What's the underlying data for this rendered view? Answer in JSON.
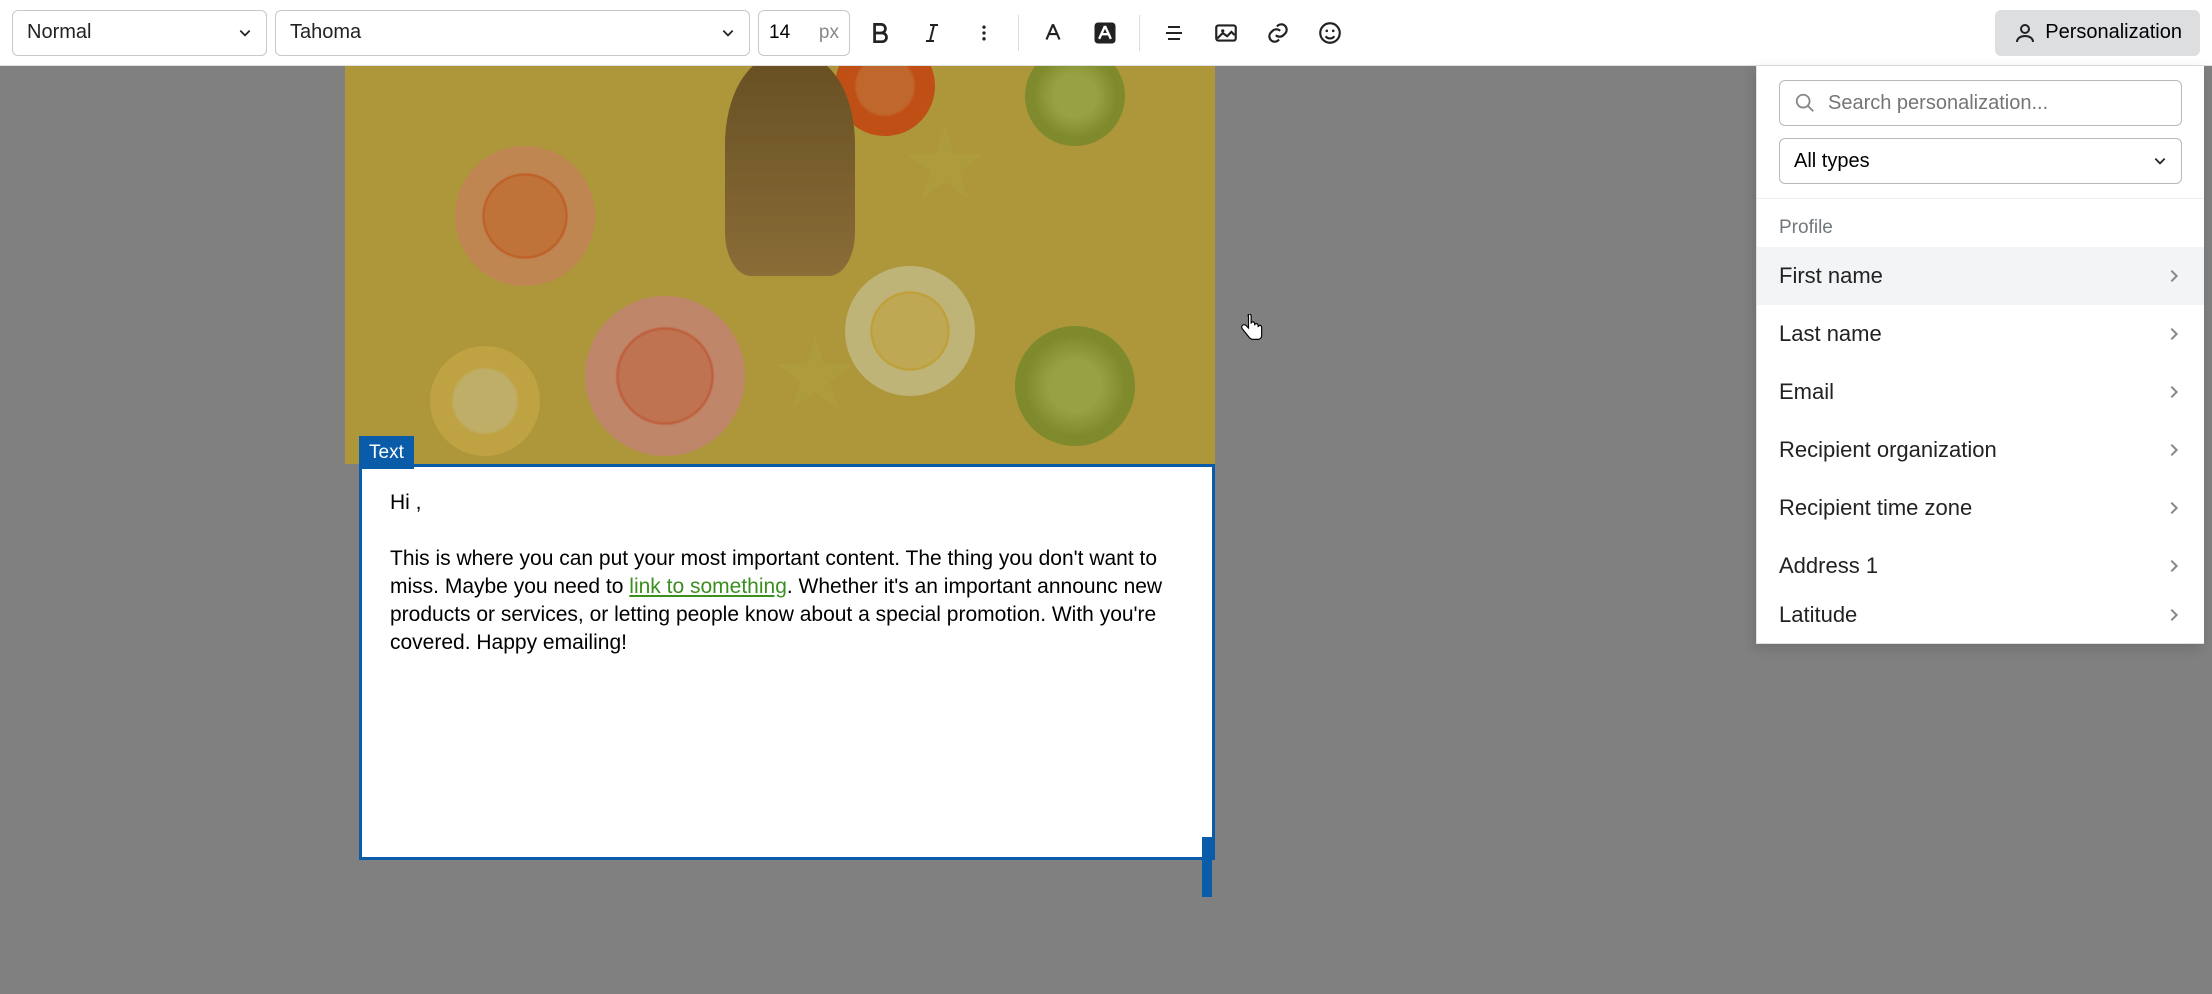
{
  "toolbar": {
    "style": "Normal",
    "font": "Tahoma",
    "size_value": "14",
    "size_unit": "px",
    "bold_label": "Bold",
    "italic_label": "Italic",
    "personalization_label": "Personalization"
  },
  "text_block": {
    "tag_label": "Text",
    "greeting": "Hi ,",
    "body_pre": "This is where you can put your most important content. The thing you don't want to miss. Maybe you need to ",
    "link_text": "link to something",
    "body_post": ". Whether it's an important announc new products or services, or letting people know about a special promotion. With you're covered. Happy emailing!"
  },
  "panel": {
    "search_placeholder": "Search personalization...",
    "type_filter": "All types",
    "section_label": "Profile",
    "items": [
      "First name",
      "Last name",
      "Email",
      "Recipient organization",
      "Recipient time zone",
      "Address 1",
      "Latitude"
    ]
  }
}
